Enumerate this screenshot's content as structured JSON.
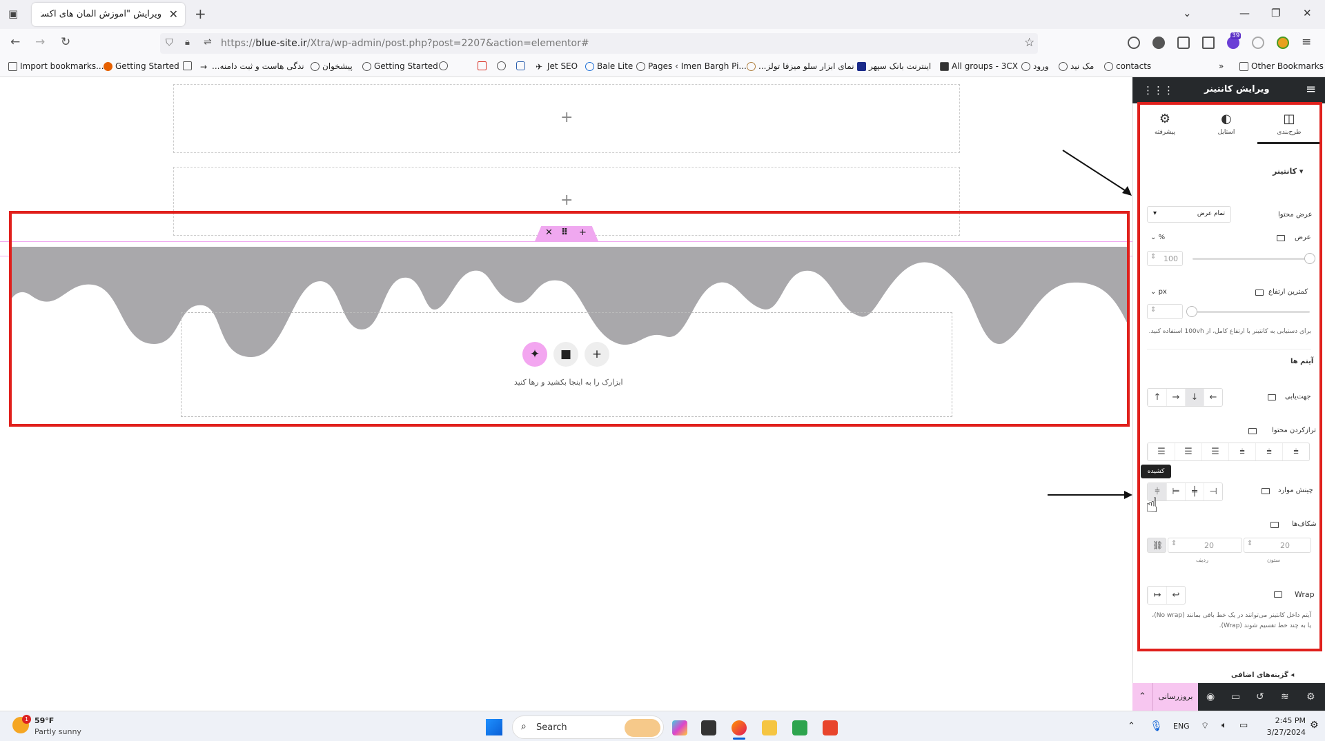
{
  "browser": {
    "tab_title": "ویرایش \"آموزش المان های اکسترا –",
    "url_prefix": "https://",
    "url_domain": "blue-site.ir",
    "url_path": "/Xtra/wp-admin/post.php?post=2207&action=elementor#",
    "ext_badge": "39"
  },
  "bookmarks": [
    {
      "label": "Import bookmarks..."
    },
    {
      "label": "Getting Started"
    },
    {
      "label": "...ندگی هاست و ثبت دامنه"
    },
    {
      "label": "پیشخوان"
    },
    {
      "label": "Getting Started"
    },
    {
      "label": "Jet SEO"
    },
    {
      "label": "Bale Lite"
    },
    {
      "label": "Pages ‹ Imen Bargh Pi..."
    },
    {
      "label": "...نمای ابزار سلو میزفا تولز"
    },
    {
      "label": "اینترنت بانک سپهر"
    },
    {
      "label": "All groups - 3CX"
    },
    {
      "label": "ورود"
    },
    {
      "label": "مک نید"
    },
    {
      "label": "contacts"
    },
    {
      "label": "Other Bookmarks"
    }
  ],
  "canvas": {
    "drop_text": "ابزارک را به اینجا بکشید و رها کنید"
  },
  "panel": {
    "title": "ویرایش کانتینر",
    "tabs": [
      {
        "label": "طرح‌بندی"
      },
      {
        "label": "استایل"
      },
      {
        "label": "پیشرفته"
      }
    ],
    "section_title": "کانتینر",
    "content_width_label": "عرض محتوا",
    "content_width_value": "تمام عرض",
    "width_label": "عرض",
    "width_unit": "%",
    "width_value": "100",
    "min_height_label": "کمترین ارتفاع",
    "min_height_unit": "px",
    "min_height_help": "برای دستیابی به کانتینر با ارتفاع کامل، از 100vh استفاده کنید.",
    "items_label": "آیتم ها",
    "direction_label": "جهت‌یابی",
    "justify_label": "ترازکردن محتوا",
    "align_label": "چینش موارد",
    "tooltip": "کشیده",
    "gaps_label": "شکاف‌ها",
    "gap_row_value": "20",
    "gap_col_value": "20",
    "gap_row_label": "ردیف",
    "gap_col_label": "ستون",
    "wrap_label": "Wrap",
    "wrap_help": "آیتم داخل کانتینر می‌توانند در یک خط باقی بمانند (No wrap)، یا به چند خط تقسیم شوند (Wrap).",
    "additional_label": "گزینه‌های اضافی",
    "update_label": "بروزرسانی"
  },
  "taskbar": {
    "temp": "59°F",
    "weather": "Partly sunny",
    "weather_badge": "1",
    "search": "Search",
    "lang": "ENG",
    "time": "2:45 PM",
    "date": "3/27/2024"
  },
  "colors": {
    "highlight_red": "#e0201c",
    "wave_gray": "#a9a8ab",
    "handle_pink": "#f0a8f0",
    "panel_dark": "#26292c"
  }
}
